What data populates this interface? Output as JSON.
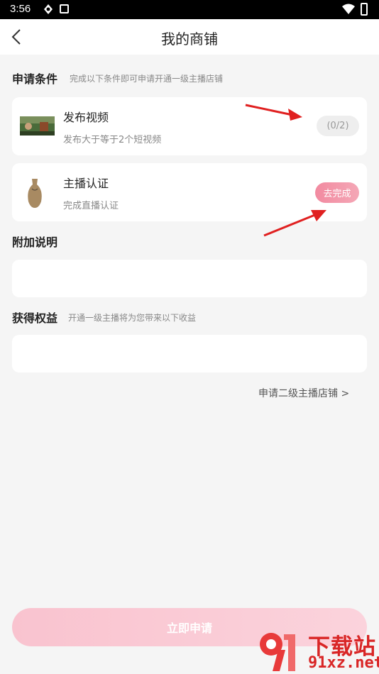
{
  "status_bar": {
    "time": "3:56"
  },
  "header": {
    "title": "我的商铺"
  },
  "conditions": {
    "title": "申请条件",
    "subtitle": "完成以下条件即可申请开通一级主播店铺",
    "items": [
      {
        "title": "发布视频",
        "desc": "发布大于等于2个短视频",
        "action": "(0/2)"
      },
      {
        "title": "主播认证",
        "desc": "完成直播认证",
        "action": "去完成"
      }
    ]
  },
  "notes": {
    "title": "附加说明"
  },
  "benefits": {
    "title": "获得权益",
    "subtitle": "开通一级主播将为您带来以下收益"
  },
  "secondary_link": "申请二级主播店铺 >",
  "submit_label": "立即申请",
  "watermark": {
    "line1": "下载站",
    "line2": "91xz.net"
  },
  "colors": {
    "accent_pink": "#f28aa0",
    "annotation_red": "#e02020"
  }
}
